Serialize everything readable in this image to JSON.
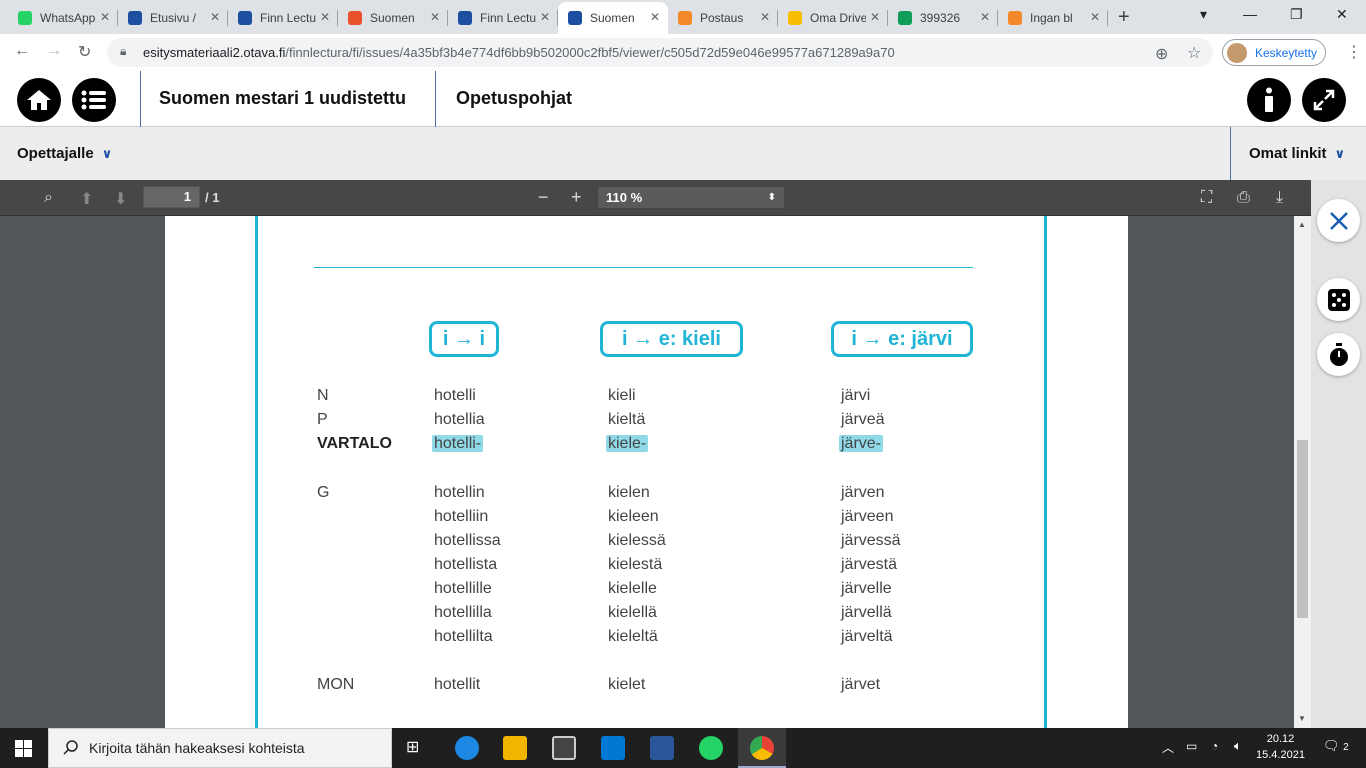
{
  "browser": {
    "tabs": [
      {
        "title": "WhatsApp",
        "icon": "whatsapp-icon",
        "color": "#25d366"
      },
      {
        "title": "Etusivu /",
        "icon": "finnlectura-icon",
        "color": "#1d4fa0"
      },
      {
        "title": "Finn Lectura",
        "icon": "finnlectura-icon",
        "color": "#1d4fa0"
      },
      {
        "title": "Suomen",
        "icon": "red-app-icon",
        "color": "#e8502c"
      },
      {
        "title": "Finn Lectura",
        "icon": "finnlectura-icon",
        "color": "#1d4fa0"
      },
      {
        "title": "Suomen",
        "icon": "finnlectura-icon",
        "color": "#1d4fa0",
        "active": true
      },
      {
        "title": "Postaus",
        "icon": "blogger-icon",
        "color": "#f4892a"
      },
      {
        "title": "Oma Drive",
        "icon": "drive-icon",
        "color": "#fbbc04"
      },
      {
        "title": "399326",
        "icon": "sheets-icon",
        "color": "#0f9d58"
      },
      {
        "title": "Ingan bl",
        "icon": "blogger-icon",
        "color": "#f4892a"
      }
    ],
    "url_host": "esitysmateriaali2.otava.fi",
    "url_path": "/finnlectura/fi/issues/4a35bf3b4e774df6bb9b502000c2fbf5/viewer/c505d72d59e046e99577a671289a9a70",
    "profile_label": "Keskeytetty"
  },
  "app": {
    "book_title": "Suomen mestari 1 uudistettu",
    "section_title": "Opetuspohjat",
    "teacher_menu": "Opettajalle",
    "links_menu": "Omat linkit"
  },
  "pdf": {
    "page_current": "1",
    "page_total": "/ 1",
    "zoom": "110 %"
  },
  "table": {
    "column_headers": [
      "i → i",
      "i → e: kieli",
      "i → e: järvi"
    ],
    "rows": [
      {
        "label": "N",
        "values": [
          "hotelli",
          "kieli",
          "järvi"
        ]
      },
      {
        "label": "P",
        "values": [
          "hotellia",
          "kieltä",
          "järveä"
        ]
      },
      {
        "label": "VARTALO",
        "values": [
          "hotelli-",
          "kiele-",
          "järve-"
        ],
        "highlight": true
      },
      {
        "label": "G",
        "values": [
          "hotellin",
          "kielen",
          "järven"
        ]
      },
      {
        "label": "",
        "values": [
          "hotelliin",
          "kieleen",
          "järveen"
        ]
      },
      {
        "label": "",
        "values": [
          "hotellissa",
          "kielessä",
          "järvessä"
        ]
      },
      {
        "label": "",
        "values": [
          "hotellista",
          "kielestä",
          "järvestä"
        ]
      },
      {
        "label": "",
        "values": [
          "hotellille",
          "kielelle",
          "järvelle"
        ]
      },
      {
        "label": "",
        "values": [
          "hotellilla",
          "kielellä",
          "järvellä"
        ]
      },
      {
        "label": "",
        "values": [
          "hotellilta",
          "kieleltä",
          "järveltä"
        ]
      },
      {
        "label": "MON",
        "values": [
          "hotellit",
          "kielet",
          "järvet"
        ]
      }
    ]
  },
  "taskbar": {
    "search_placeholder": "Kirjoita tähän hakeaksesi kohteista",
    "time": "20.12",
    "date": "15.4.2021",
    "notifications": "2"
  },
  "colors": {
    "accent": "#20b4d6",
    "highlight": "#8fd9e8",
    "toolbar": "#474747"
  }
}
